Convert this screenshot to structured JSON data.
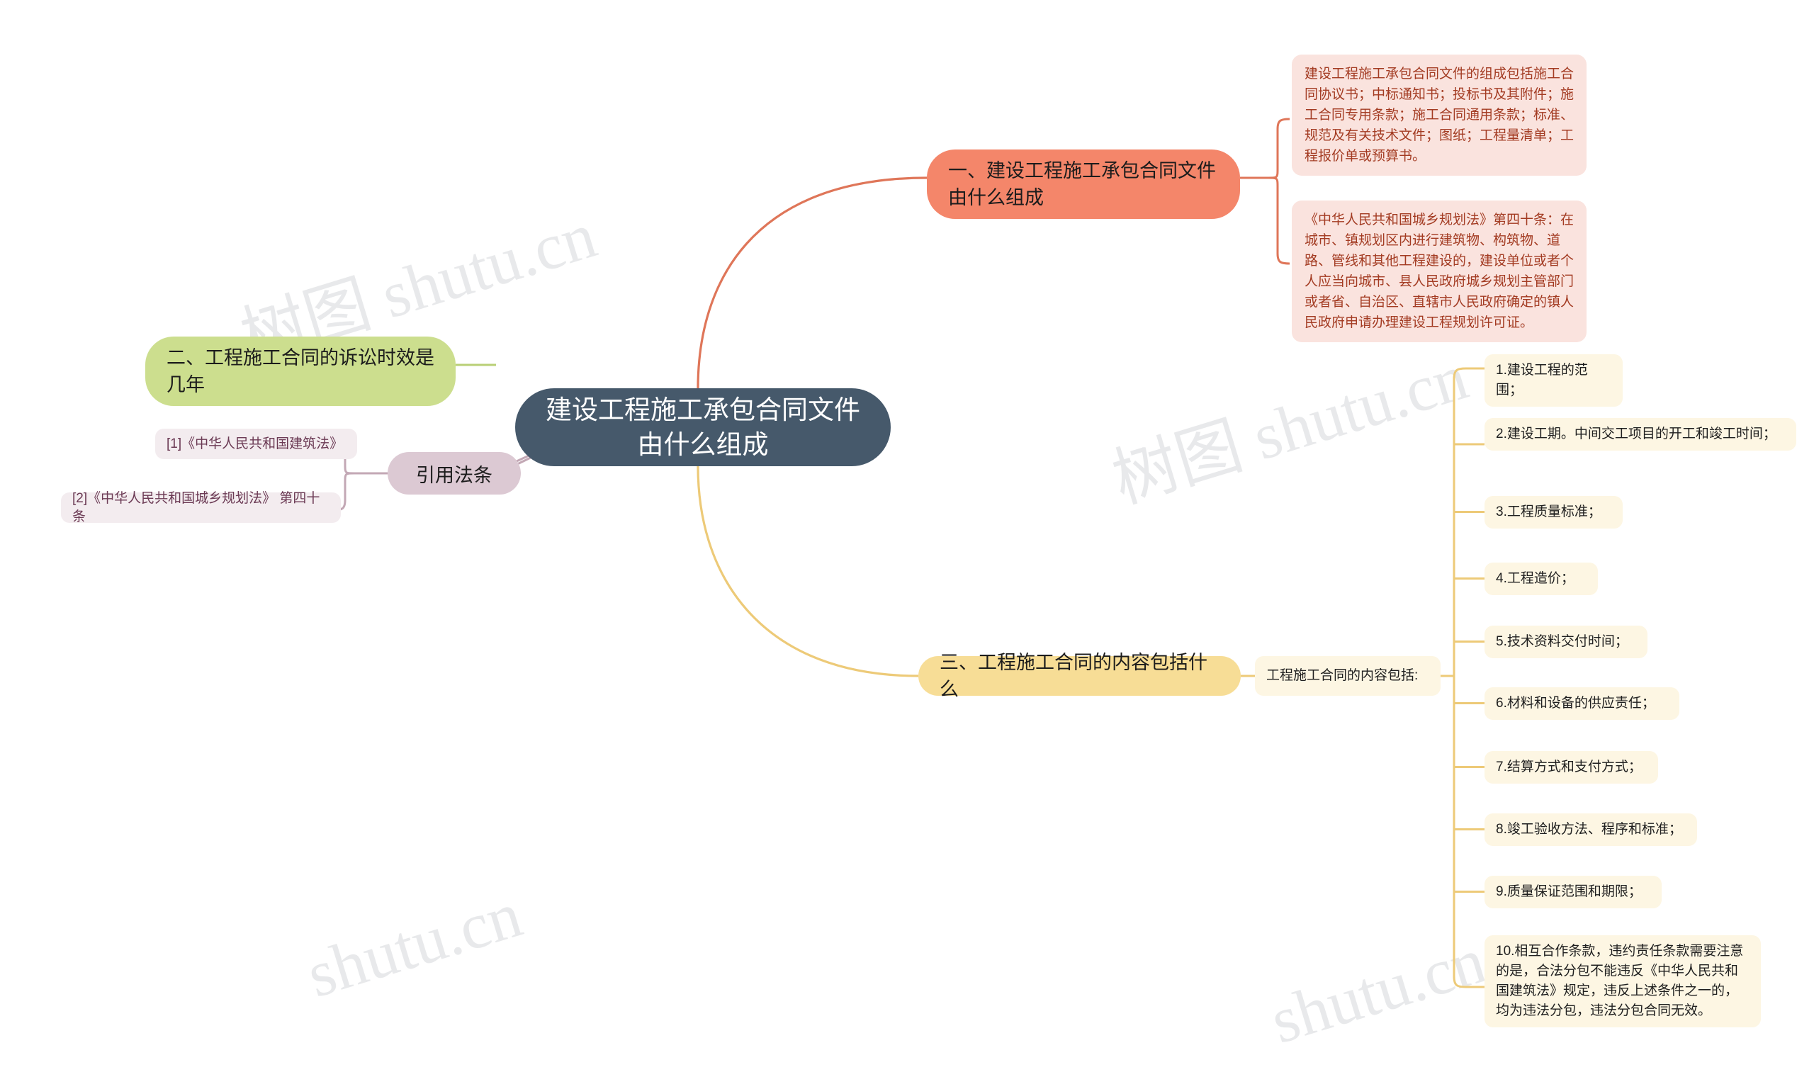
{
  "meta": {
    "title": "建设工程施工承包合同文件由什么组成",
    "watermarks": [
      "树图 shutu.cn",
      "树图 shutu.cn",
      "shutu.cn",
      "shutu.cn"
    ],
    "colors": {
      "root_fill": "#46596b",
      "root_text": "#ffffff",
      "branch1_fill": "#f4866a",
      "branch2_fill": "#ccde8e",
      "branch3_fill": "#f7dd96",
      "sub_pill_fill": "#dcc9d3",
      "citation_fill": "#f3ecef",
      "citation_text": "#6b3a54",
      "redbox_fill": "#fae3de",
      "redbox_text": "#a33b22",
      "yellowbox_fill": "#fdf6e3",
      "link_orange": "#df7659",
      "link_green": "#b9cf76",
      "link_yellow": "#edca78",
      "link_mauve": "#c3a8b5",
      "background": "#ffffff"
    }
  },
  "root": {
    "label": "建设工程施工承包合同文件由什么组成"
  },
  "branches": {
    "one": {
      "label": "一、建设工程施工承包合同文件由什么组成",
      "details": [
        "建设工程施工承包合同文件的组成包括施工合同协议书；中标通知书；投标书及其附件；施工合同专用条款；施工合同通用条款；标准、规范及有关技术文件；图纸；工程量清单；工程报价单或预算书。",
        "《中华人民共和国城乡规划法》第四十条：在城市、镇规划区内进行建筑物、构筑物、道路、管线和其他工程建设的，建设单位或者个人应当向城市、县人民政府城乡规划主管部门或者省、自治区、直辖市人民政府确定的镇人民政府申请办理建设工程规划许可证。"
      ]
    },
    "two": {
      "label": "二、工程施工合同的诉讼时效是几年",
      "sub_label": "引用法条",
      "citations": [
        "[1]《中华人民共和国建筑法》",
        "[2]《中华人民共和国城乡规划法》 第四十条"
      ]
    },
    "three": {
      "label": "三、工程施工合同的内容包括什么",
      "lead": "工程施工合同的内容包括:",
      "items": [
        "1.建设工程的范围；",
        "2.建设工期。中间交工项目的开工和竣工时间；",
        "3.工程质量标准；",
        "4.工程造价；",
        "5.技术资料交付时间；",
        "6.材料和设备的供应责任；",
        "7.结算方式和支付方式；",
        "8.竣工验收方法、程序和标准；",
        "9.质量保证范围和期限；",
        "10.相互合作条款，违约责任条款需要注意的是，合法分包不能违反《中华人民共和国建筑法》规定，违反上述条件之一的，均为违法分包，违法分包合同无效。"
      ]
    }
  }
}
